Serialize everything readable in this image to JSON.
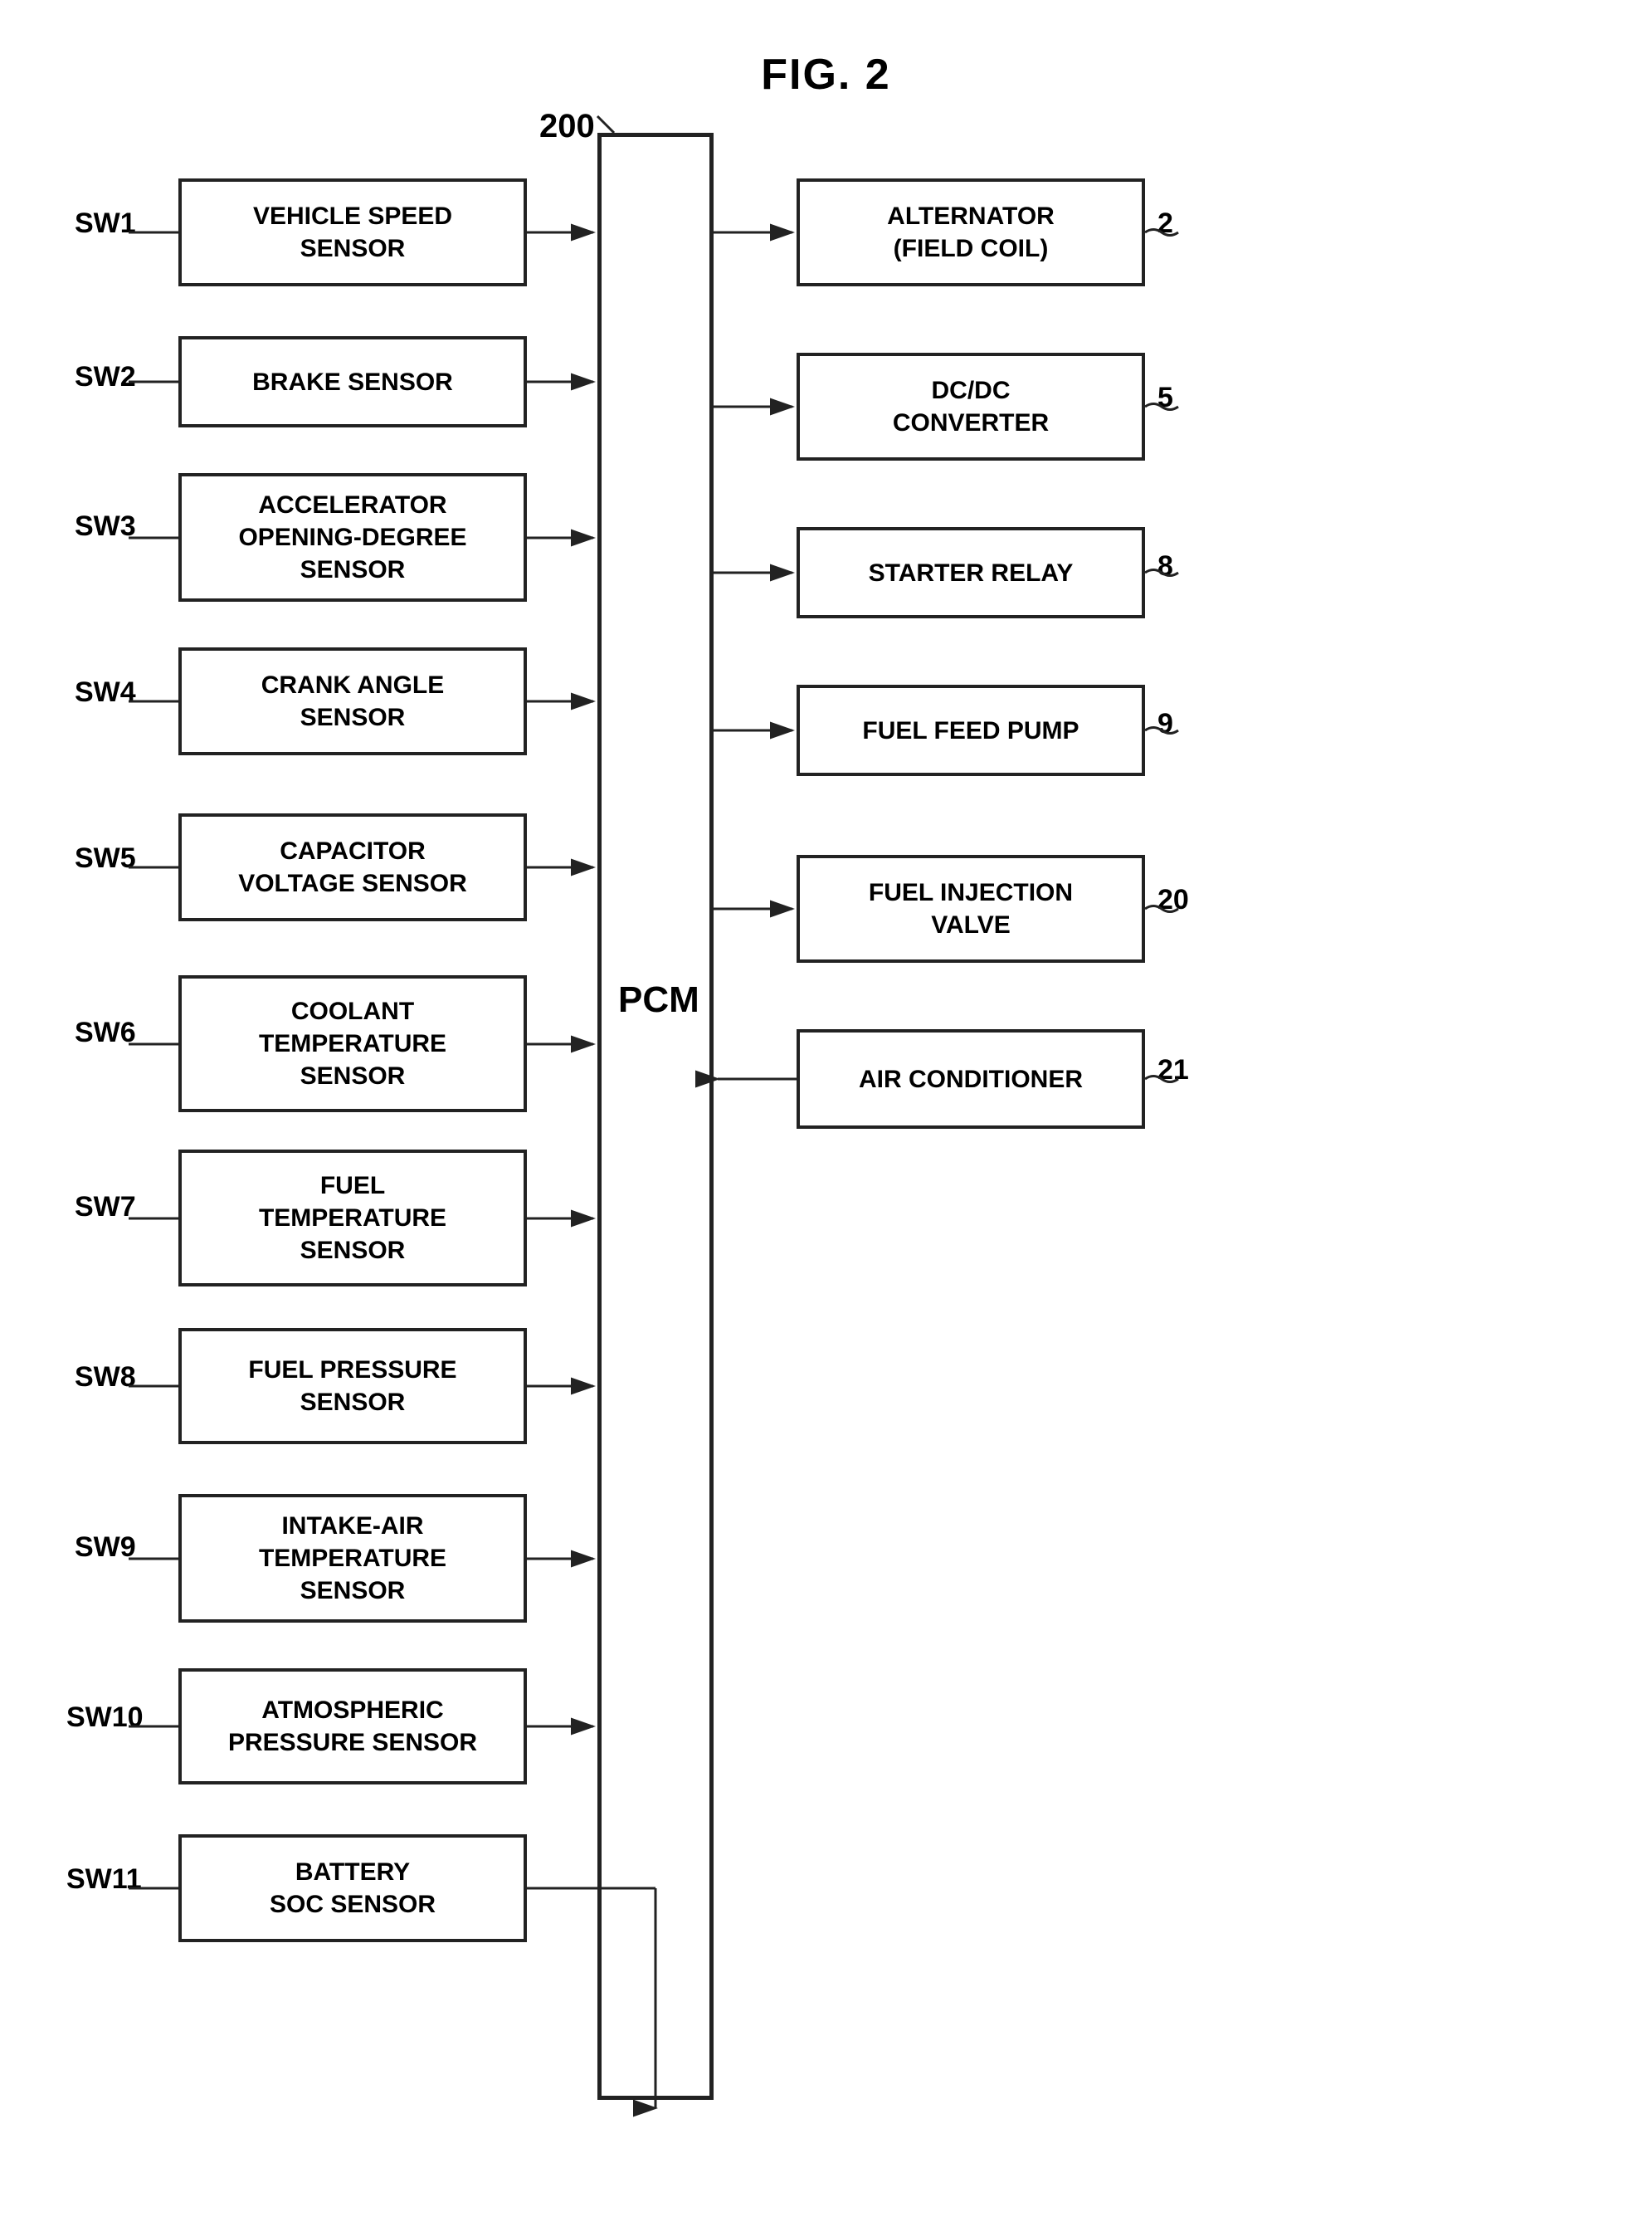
{
  "title": "FIG. 2",
  "pcm_label": "PCM",
  "pcm_ref": "200",
  "inputs": [
    {
      "sw": "SW1",
      "label": "VEHICLE SPEED\nSENSOR"
    },
    {
      "sw": "SW2",
      "label": "BRAKE SENSOR"
    },
    {
      "sw": "SW3",
      "label": "ACCELERATOR\nOPENING-DEGREE\nSENSOR"
    },
    {
      "sw": "SW4",
      "label": "CRANK ANGLE\nSENSOR"
    },
    {
      "sw": "SW5",
      "label": "CAPACITOR\nVOLTAGE SENSOR"
    },
    {
      "sw": "SW6",
      "label": "COOLANT\nTEMPERATURE\nSENSOR"
    },
    {
      "sw": "SW7",
      "label": "FUEL\nTEMPERATURE\nSENSOR"
    },
    {
      "sw": "SW8",
      "label": "FUEL PRESSURE\nSENSOR"
    },
    {
      "sw": "SW9",
      "label": "INTAKE-AIR\nTEMPERATURE\nSENSOR"
    },
    {
      "sw": "SW10",
      "label": "ATMOSPHERIC\nPRESSURE SENSOR"
    },
    {
      "sw": "SW11",
      "label": "BATTERY\nSOC SENSOR"
    }
  ],
  "outputs": [
    {
      "ref": "2",
      "label": "ALTERNATOR\n(FIELD COIL)"
    },
    {
      "ref": "5",
      "label": "DC/DC\nCONVERTER"
    },
    {
      "ref": "8",
      "label": "STARTER RELAY"
    },
    {
      "ref": "9",
      "label": "FUEL FEED PUMP"
    },
    {
      "ref": "20",
      "label": "FUEL INJECTION\nVALVE"
    },
    {
      "ref": "21",
      "label": "AIR CONDITIONER",
      "arrow_in": true
    }
  ]
}
